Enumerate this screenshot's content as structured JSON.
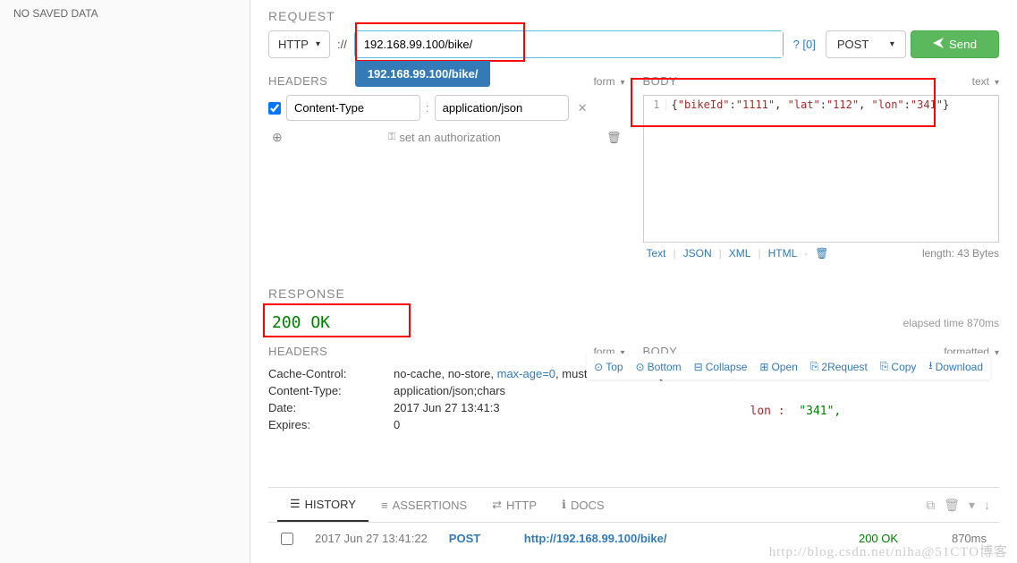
{
  "sidebar": {
    "no_saved": "NO SAVED DATA"
  },
  "request": {
    "title": "REQUEST",
    "protocol": "HTTP",
    "prefix": "://",
    "url": "192.168.99.100/bike/",
    "autocomplete": "192.168.99.100/bike/",
    "qmark": "? [0]",
    "method": "POST",
    "send": "Send"
  },
  "headers": {
    "title": "HEADERS",
    "mode": "form",
    "items": [
      {
        "checked": true,
        "name": "Content-Type",
        "value": "application/json"
      }
    ],
    "auth_text": "set an authorization"
  },
  "body": {
    "title": "BODY",
    "mode": "text",
    "raw": "{\"bikeId\":\"1111\", \"lat\":\"112\", \"lon\":\"341\"}",
    "tabs": [
      "Text",
      "JSON",
      "XML",
      "HTML"
    ],
    "length": "length: 43 Bytes"
  },
  "response": {
    "title": "RESPONSE",
    "status": "200 OK",
    "elapsed": "elapsed time 870ms",
    "headers_title": "HEADERS",
    "headers_mode": "form",
    "body_title": "BODY",
    "body_mode": "formatted",
    "headers": [
      {
        "name": "Cache-Control:",
        "value_pre": "no-cache, no-store, ",
        "maxage": "max-age=0",
        "value_post": ", must"
      },
      {
        "name": "Content-Type:",
        "value_pre": "application/json;chars",
        "maxage": "",
        "value_post": ""
      },
      {
        "name": "Date:",
        "value_pre": "2017 Jun 27 13:41:3",
        "maxage": "",
        "value_post": ""
      },
      {
        "name": "Expires:",
        "value_pre": "0",
        "maxage": "",
        "value_post": ""
      }
    ],
    "body_json": {
      "key": "lon :",
      "val": "\"341\","
    }
  },
  "toolbar": {
    "top": "Top",
    "bottom": "Bottom",
    "collapse": "Collapse",
    "open": "Open",
    "torequest": "2Request",
    "copy": "Copy",
    "download": "Download"
  },
  "tabs": {
    "history": "HISTORY",
    "assertions": "ASSERTIONS",
    "http": "HTTP",
    "docs": "DOCS"
  },
  "history": {
    "time": "2017 Jun 27 13:41:22",
    "method": "POST",
    "url": "http://192.168.99.100/bike/",
    "status": "200 OK",
    "duration": "870ms"
  },
  "watermark": "http://blog.csdn.net/niha@51CTO博客"
}
